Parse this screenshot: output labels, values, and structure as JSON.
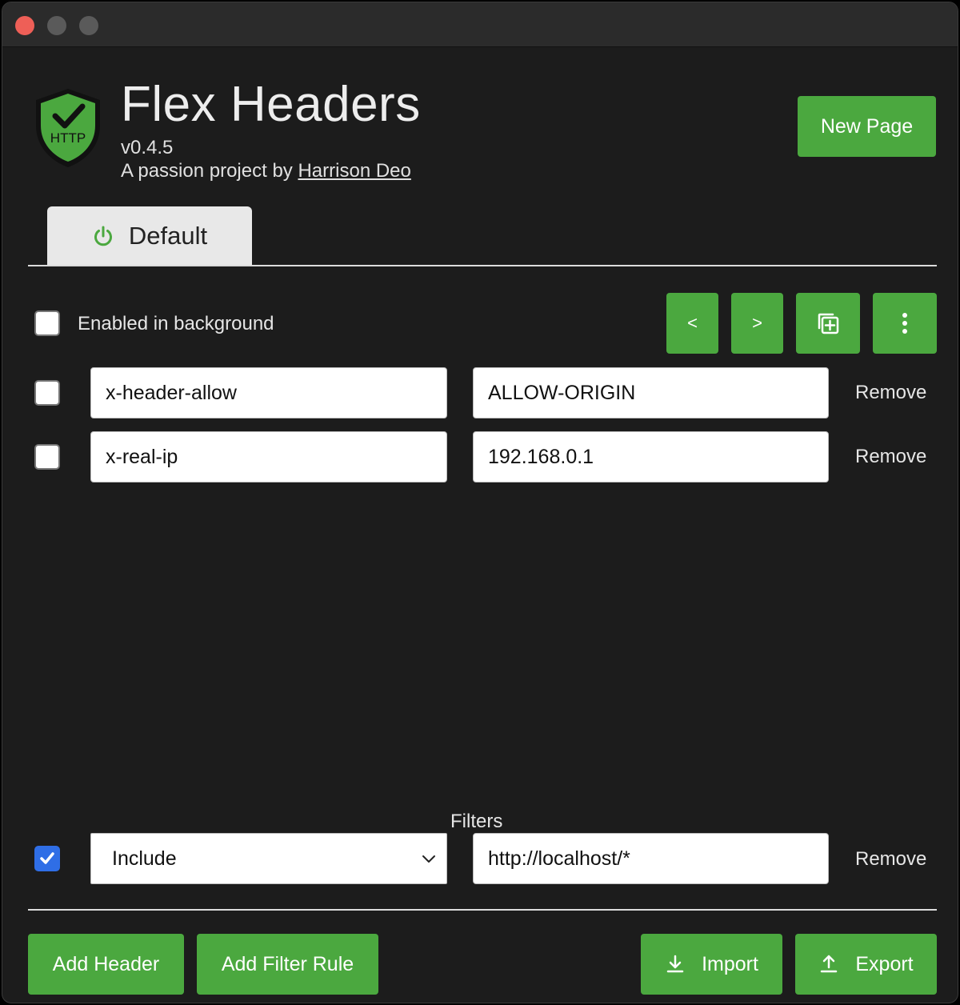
{
  "app": {
    "title": "Flex Headers",
    "version": "v0.4.5",
    "byline_prefix": "A passion project by ",
    "author": "Harrison Deo",
    "logo_text": "HTTP"
  },
  "header": {
    "new_page_label": "New Page"
  },
  "tabs": [
    {
      "label": "Default",
      "icon": "power-icon"
    }
  ],
  "toolbar": {
    "enabled_label": "Enabled in background",
    "enabled_checked": false,
    "prev_label": "<",
    "next_label": ">",
    "duplicate_icon": "duplicate-icon",
    "menu_icon": "more-vertical-icon"
  },
  "headers": [
    {
      "enabled": false,
      "name": "x-header-allow",
      "value": "ALLOW-ORIGIN",
      "remove_label": "Remove"
    },
    {
      "enabled": false,
      "name": "x-real-ip",
      "value": "192.168.0.1",
      "remove_label": "Remove"
    }
  ],
  "filters": {
    "section_label": "Filters",
    "rules": [
      {
        "enabled": true,
        "type": "Include",
        "pattern": "http://localhost/*",
        "remove_label": "Remove"
      }
    ]
  },
  "footer": {
    "add_header_label": "Add Header",
    "add_filter_label": "Add Filter Rule",
    "import_label": "Import",
    "export_label": "Export"
  },
  "colors": {
    "accent": "#4ba83f",
    "background": "#1c1c1c",
    "checkbox_checked": "#2f6ee6"
  }
}
